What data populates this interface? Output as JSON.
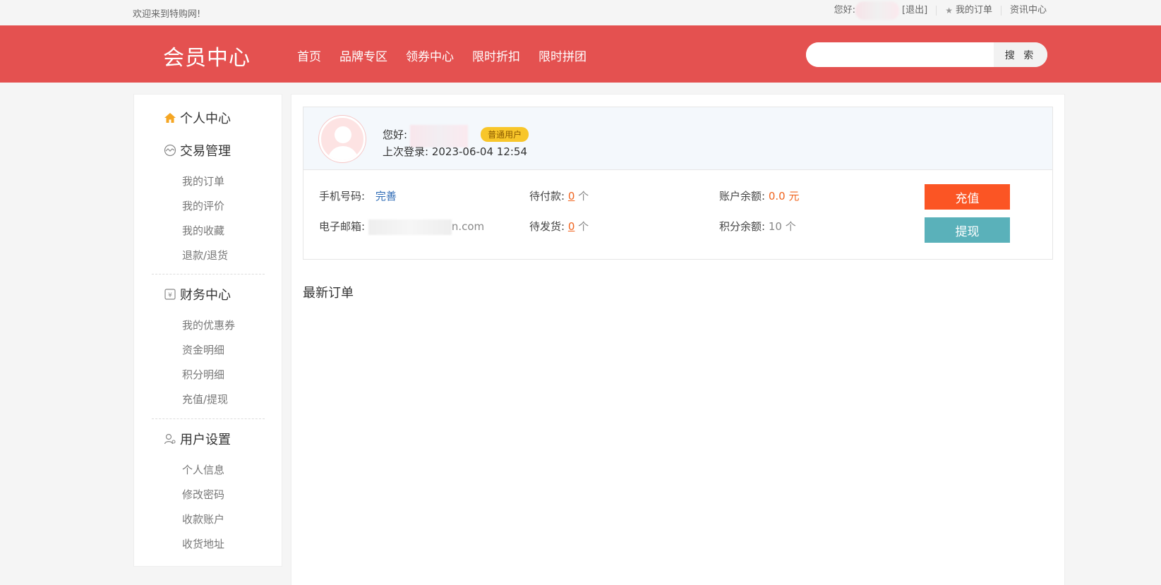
{
  "topbar": {
    "welcome": "欢迎来到特购网!",
    "greeting": "您好:",
    "logout": "[退出]",
    "my_orders": "我的订单",
    "news": "资讯中心"
  },
  "header": {
    "logo": "会员中心",
    "nav": [
      "首页",
      "品牌专区",
      "领券中心",
      "限时折扣",
      "限时拼团"
    ],
    "search_placeholder": "",
    "search_button": "搜 索"
  },
  "sidebar": {
    "personal_center": "个人中心",
    "trade": {
      "title": "交易管理",
      "items": [
        "我的订单",
        "我的评价",
        "我的收藏",
        "退款/退货"
      ]
    },
    "finance": {
      "title": "财务中心",
      "items": [
        "我的优惠券",
        "资金明细",
        "积分明细",
        "充值/提现"
      ]
    },
    "settings": {
      "title": "用户设置",
      "items": [
        "个人信息",
        "修改密码",
        "收款账户",
        "收货地址"
      ]
    }
  },
  "profile": {
    "hello_label": "您好:",
    "level_badge": "普通用户",
    "last_login_label": "上次登录:",
    "last_login_value": "2023-06-04 12:54",
    "phone_label": "手机号码:",
    "phone_action": "完善",
    "email_label": "电子邮箱:",
    "email_suffix": "n.com",
    "pending_pay_label": "待付款:",
    "pending_pay_count": "0",
    "pending_ship_label": "待发货:",
    "pending_ship_count": "0",
    "count_unit": "个",
    "balance_label": "账户余额:",
    "balance_value": "0.0 元",
    "points_label": "积分余额:",
    "points_value": "10 个",
    "recharge_button": "充值",
    "withdraw_button": "提现"
  },
  "latest_orders_title": "最新订单",
  "colors": {
    "brand": "#e45150",
    "accent_orange": "#fb5524",
    "teal": "#5ab1ba",
    "badge": "#f8c62a"
  }
}
